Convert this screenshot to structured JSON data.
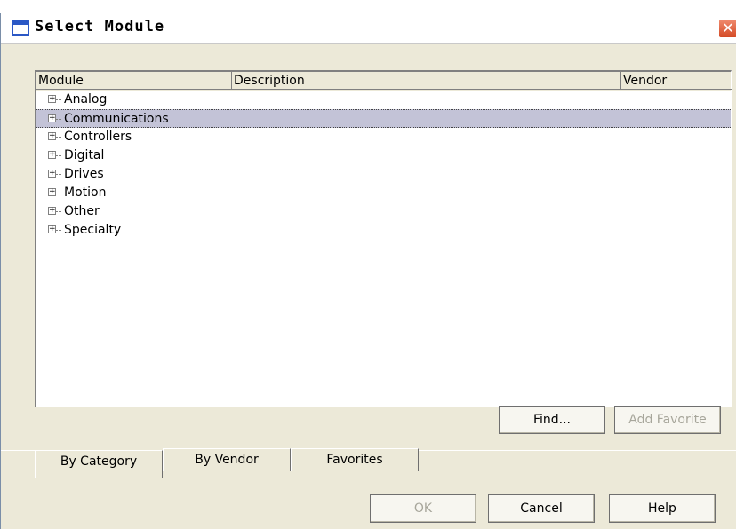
{
  "window": {
    "title": "Select Module",
    "close_label": "✕"
  },
  "tree": {
    "columns": [
      "Module",
      "Description",
      "Vendor"
    ],
    "items": [
      {
        "label": "Analog",
        "selected": false
      },
      {
        "label": "Communications",
        "selected": true
      },
      {
        "label": "Controllers",
        "selected": false
      },
      {
        "label": "Digital",
        "selected": false
      },
      {
        "label": "Drives",
        "selected": false
      },
      {
        "label": "Motion",
        "selected": false
      },
      {
        "label": "Other",
        "selected": false
      },
      {
        "label": "Specialty",
        "selected": false
      }
    ],
    "expander_glyph": "+"
  },
  "buttons": {
    "find": "Find...",
    "add_favorite": "Add Favorite",
    "ok": "OK",
    "cancel": "Cancel",
    "help": "Help"
  },
  "tabs": [
    {
      "label": "By Category",
      "active": true
    },
    {
      "label": "By Vendor",
      "active": false
    },
    {
      "label": "Favorites",
      "active": false
    }
  ],
  "colors": {
    "dialog_bg": "#ece9d8",
    "selection_bg": "#c3c3d7",
    "close_button": "#d44a25"
  }
}
